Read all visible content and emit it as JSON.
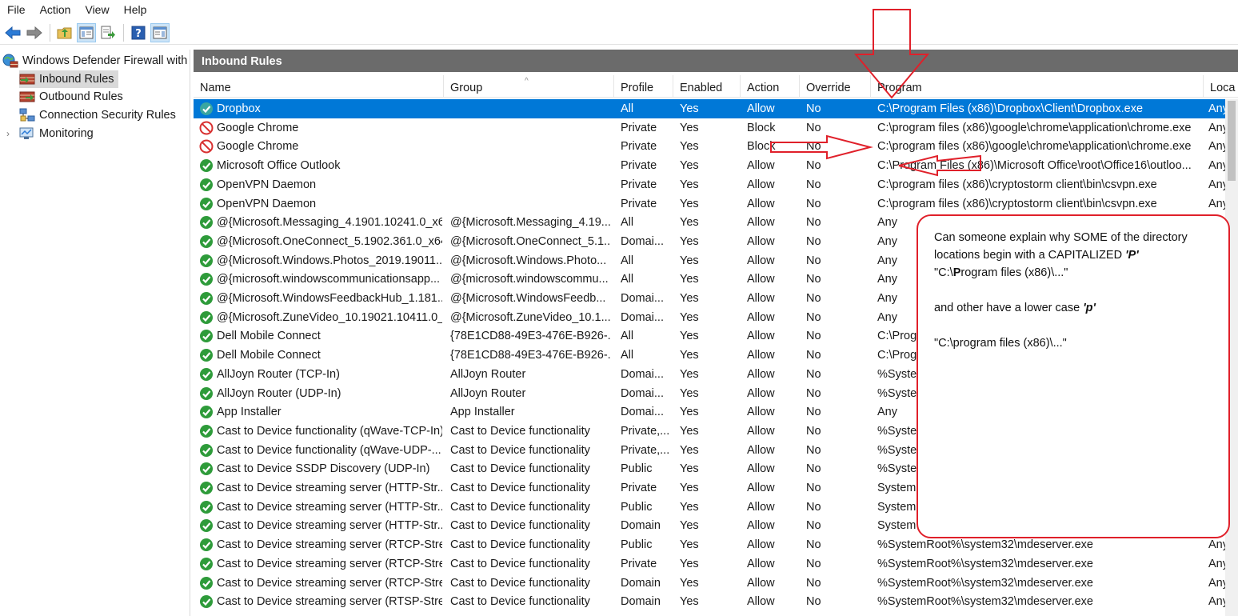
{
  "menu": [
    "File",
    "Action",
    "View",
    "Help"
  ],
  "toolbar": {
    "icons": [
      "back-arrow-icon",
      "forward-arrow-icon",
      "up-folder-icon",
      "show-hide-tree-icon",
      "export-list-icon",
      "help-icon",
      "show-hide-action-pane-icon"
    ]
  },
  "tree": {
    "root": "Windows Defender Firewall with",
    "items": [
      "Inbound Rules",
      "Outbound Rules",
      "Connection Security Rules",
      "Monitoring"
    ]
  },
  "panel": {
    "title": "Inbound Rules",
    "columns": [
      "Name",
      "Group",
      "Profile",
      "Enabled",
      "Action",
      "Override",
      "Program",
      "Loca"
    ]
  },
  "rows": [
    {
      "name": "Dropbox",
      "group": "",
      "profile": "All",
      "enabled": "Yes",
      "action": "Allow",
      "override": "No",
      "program": "C:\\Program Files (x86)\\Dropbox\\Client\\Dropbox.exe",
      "local": "Any",
      "status": "allow",
      "selected": true
    },
    {
      "name": "Google Chrome",
      "group": "",
      "profile": "Private",
      "enabled": "Yes",
      "action": "Block",
      "override": "No",
      "program": "C:\\program files (x86)\\google\\chrome\\application\\chrome.exe",
      "local": "Any",
      "status": "block"
    },
    {
      "name": "Google Chrome",
      "group": "",
      "profile": "Private",
      "enabled": "Yes",
      "action": "Block",
      "override": "No",
      "program": "C:\\program files (x86)\\google\\chrome\\application\\chrome.exe",
      "local": "Any",
      "status": "block"
    },
    {
      "name": "Microsoft Office Outlook",
      "group": "",
      "profile": "Private",
      "enabled": "Yes",
      "action": "Allow",
      "override": "No",
      "program": "C:\\Program Files (x86)\\Microsoft Office\\root\\Office16\\outloo...",
      "local": "Any",
      "status": "allow"
    },
    {
      "name": "OpenVPN Daemon",
      "group": "",
      "profile": "Private",
      "enabled": "Yes",
      "action": "Allow",
      "override": "No",
      "program": "C:\\program files (x86)\\cryptostorm client\\bin\\csvpn.exe",
      "local": "Any",
      "status": "allow"
    },
    {
      "name": "OpenVPN Daemon",
      "group": "",
      "profile": "Private",
      "enabled": "Yes",
      "action": "Allow",
      "override": "No",
      "program": "C:\\program files (x86)\\cryptostorm client\\bin\\csvpn.exe",
      "local": "Any",
      "status": "allow"
    },
    {
      "name": "@{Microsoft.Messaging_4.1901.10241.0_x6...",
      "group": "@{Microsoft.Messaging_4.19...",
      "profile": "All",
      "enabled": "Yes",
      "action": "Allow",
      "override": "No",
      "program": "Any",
      "local": "",
      "status": "allow"
    },
    {
      "name": "@{Microsoft.OneConnect_5.1902.361.0_x64...",
      "group": "@{Microsoft.OneConnect_5.1...",
      "profile": "Domai...",
      "enabled": "Yes",
      "action": "Allow",
      "override": "No",
      "program": "Any",
      "local": "",
      "status": "allow"
    },
    {
      "name": "@{Microsoft.Windows.Photos_2019.19011....",
      "group": "@{Microsoft.Windows.Photo...",
      "profile": "All",
      "enabled": "Yes",
      "action": "Allow",
      "override": "No",
      "program": "Any",
      "local": "",
      "status": "allow"
    },
    {
      "name": "@{microsoft.windowscommunicationsapp...",
      "group": "@{microsoft.windowscommu...",
      "profile": "All",
      "enabled": "Yes",
      "action": "Allow",
      "override": "No",
      "program": "Any",
      "local": "",
      "status": "allow"
    },
    {
      "name": "@{Microsoft.WindowsFeedbackHub_1.181...",
      "group": "@{Microsoft.WindowsFeedb...",
      "profile": "Domai...",
      "enabled": "Yes",
      "action": "Allow",
      "override": "No",
      "program": "Any",
      "local": "",
      "status": "allow"
    },
    {
      "name": "@{Microsoft.ZuneVideo_10.19021.10411.0_...",
      "group": "@{Microsoft.ZuneVideo_10.1...",
      "profile": "Domai...",
      "enabled": "Yes",
      "action": "Allow",
      "override": "No",
      "program": "Any",
      "local": "",
      "status": "allow"
    },
    {
      "name": "Dell Mobile Connect",
      "group": "{78E1CD88-49E3-476E-B926-...",
      "profile": "All",
      "enabled": "Yes",
      "action": "Allow",
      "override": "No",
      "program": "C:\\Prog",
      "local": "",
      "status": "allow"
    },
    {
      "name": "Dell Mobile Connect",
      "group": "{78E1CD88-49E3-476E-B926-...",
      "profile": "All",
      "enabled": "Yes",
      "action": "Allow",
      "override": "No",
      "program": "C:\\Prog",
      "local": "",
      "status": "allow"
    },
    {
      "name": "AllJoyn Router (TCP-In)",
      "group": "AllJoyn Router",
      "profile": "Domai...",
      "enabled": "Yes",
      "action": "Allow",
      "override": "No",
      "program": "%System",
      "local": "",
      "status": "allow"
    },
    {
      "name": "AllJoyn Router (UDP-In)",
      "group": "AllJoyn Router",
      "profile": "Domai...",
      "enabled": "Yes",
      "action": "Allow",
      "override": "No",
      "program": "%System",
      "local": "",
      "status": "allow"
    },
    {
      "name": "App Installer",
      "group": "App Installer",
      "profile": "Domai...",
      "enabled": "Yes",
      "action": "Allow",
      "override": "No",
      "program": "Any",
      "local": "",
      "status": "allow"
    },
    {
      "name": "Cast to Device functionality (qWave-TCP-In)",
      "group": "Cast to Device functionality",
      "profile": "Private,...",
      "enabled": "Yes",
      "action": "Allow",
      "override": "No",
      "program": "%Syster",
      "local": "",
      "status": "allow"
    },
    {
      "name": "Cast to Device functionality (qWave-UDP-...",
      "group": "Cast to Device functionality",
      "profile": "Private,...",
      "enabled": "Yes",
      "action": "Allow",
      "override": "No",
      "program": "%Syster",
      "local": "",
      "status": "allow"
    },
    {
      "name": "Cast to Device SSDP Discovery (UDP-In)",
      "group": "Cast to Device functionality",
      "profile": "Public",
      "enabled": "Yes",
      "action": "Allow",
      "override": "No",
      "program": "%Syster",
      "local": "",
      "status": "allow"
    },
    {
      "name": "Cast to Device streaming server (HTTP-Str...",
      "group": "Cast to Device functionality",
      "profile": "Private",
      "enabled": "Yes",
      "action": "Allow",
      "override": "No",
      "program": "System",
      "local": "",
      "status": "allow"
    },
    {
      "name": "Cast to Device streaming server (HTTP-Str...",
      "group": "Cast to Device functionality",
      "profile": "Public",
      "enabled": "Yes",
      "action": "Allow",
      "override": "No",
      "program": "System",
      "local": "",
      "status": "allow"
    },
    {
      "name": "Cast to Device streaming server (HTTP-Str...",
      "group": "Cast to Device functionality",
      "profile": "Domain",
      "enabled": "Yes",
      "action": "Allow",
      "override": "No",
      "program": "System",
      "local": "",
      "status": "allow"
    },
    {
      "name": "Cast to Device streaming server (RTCP-Stre...",
      "group": "Cast to Device functionality",
      "profile": "Public",
      "enabled": "Yes",
      "action": "Allow",
      "override": "No",
      "program": "%SystemRoot%\\system32\\mdeserver.exe",
      "local": "Any",
      "status": "allow"
    },
    {
      "name": "Cast to Device streaming server (RTCP-Stre...",
      "group": "Cast to Device functionality",
      "profile": "Private",
      "enabled": "Yes",
      "action": "Allow",
      "override": "No",
      "program": "%SystemRoot%\\system32\\mdeserver.exe",
      "local": "Any",
      "status": "allow"
    },
    {
      "name": "Cast to Device streaming server (RTCP-Stre...",
      "group": "Cast to Device functionality",
      "profile": "Domain",
      "enabled": "Yes",
      "action": "Allow",
      "override": "No",
      "program": "%SystemRoot%\\system32\\mdeserver.exe",
      "local": "Any",
      "status": "allow"
    },
    {
      "name": "Cast to Device streaming server (RTSP-Stre...",
      "group": "Cast to Device functionality",
      "profile": "Domain",
      "enabled": "Yes",
      "action": "Allow",
      "override": "No",
      "program": "%SystemRoot%\\system32\\mdeserver.exe",
      "local": "Any",
      "status": "allow"
    }
  ],
  "callout": {
    "line1": "Can someone explain why SOME of the directory",
    "line2a": "locations begin with a CAPITALIZED ",
    "line2b": "'P'",
    "line3a": "\"C:\\",
    "line3b": "P",
    "line3c": "rogram files (x86)\\...\"",
    "line4a": "and other have a lower case ",
    "line4b": "'p'",
    "line5": "\"C:\\program files (x86)\\...\""
  },
  "colors": {
    "accent_red": "#e0202a",
    "selection": "#0078d7",
    "header_bar": "#6b6b6b",
    "allow_green": "#2e9b3a",
    "block_red": "#d83030"
  }
}
